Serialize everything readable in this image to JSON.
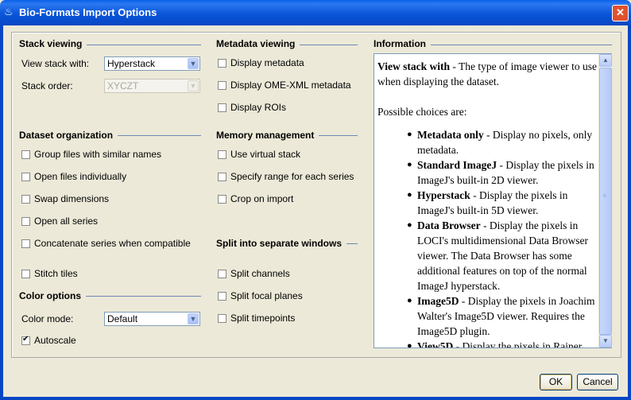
{
  "window": {
    "title": "Bio-Formats Import Options",
    "close_label": "✕"
  },
  "stack_viewing": {
    "title": "Stack viewing",
    "view_label": "View stack with:",
    "view_value": "Hyperstack",
    "order_label": "Stack order:",
    "order_value": "XYCZT"
  },
  "dataset_org": {
    "title": "Dataset organization",
    "items": [
      {
        "label": "Group files with similar names",
        "checked": false
      },
      {
        "label": "Open files individually",
        "checked": false
      },
      {
        "label": "Swap dimensions",
        "checked": false
      },
      {
        "label": "Open all series",
        "checked": false
      },
      {
        "label": "Concatenate series when compatible",
        "checked": false
      },
      {
        "label": "Stitch tiles",
        "checked": false
      }
    ]
  },
  "color_options": {
    "title": "Color options",
    "mode_label": "Color mode:",
    "mode_value": "Default",
    "autoscale_label": "Autoscale",
    "autoscale_checked": true
  },
  "metadata_viewing": {
    "title": "Metadata viewing",
    "items": [
      {
        "label": "Display metadata",
        "checked": false
      },
      {
        "label": "Display OME-XML metadata",
        "checked": false
      },
      {
        "label": "Display ROIs",
        "checked": false
      }
    ]
  },
  "memory": {
    "title": "Memory management",
    "items": [
      {
        "label": "Use virtual stack",
        "checked": false
      },
      {
        "label": "Specify range for each series",
        "checked": false
      },
      {
        "label": "Crop on import",
        "checked": false
      }
    ]
  },
  "split": {
    "title": "Split into separate windows",
    "items": [
      {
        "label": "Split channels",
        "checked": false
      },
      {
        "label": "Split focal planes",
        "checked": false
      },
      {
        "label": "Split timepoints",
        "checked": false
      }
    ]
  },
  "information": {
    "title": "Information",
    "heading": "View stack with",
    "heading_desc": " - The type of image viewer to use when displaying the dataset.",
    "choices_intro": "Possible choices are:",
    "choices": [
      {
        "name": "Metadata only",
        "desc": " - Display no pixels, only metadata."
      },
      {
        "name": "Standard ImageJ",
        "desc": " - Display the pixels in ImageJ's built-in 2D viewer."
      },
      {
        "name": "Hyperstack",
        "desc": " - Display the pixels in ImageJ's built-in 5D viewer."
      },
      {
        "name": "Data Browser",
        "desc": " - Display the pixels in LOCI's multidimensional Data Browser viewer.  The Data Browser has some additional features on top of the normal ImageJ hyperstack."
      },
      {
        "name": "Image5D",
        "desc": " - Display the pixels in Joachim Walter's Image5D viewer. Requires the Image5D plugin."
      },
      {
        "name": "View5D",
        "desc": " - Display the pixels in Rainer"
      }
    ]
  },
  "buttons": {
    "ok": "OK",
    "cancel": "Cancel"
  }
}
